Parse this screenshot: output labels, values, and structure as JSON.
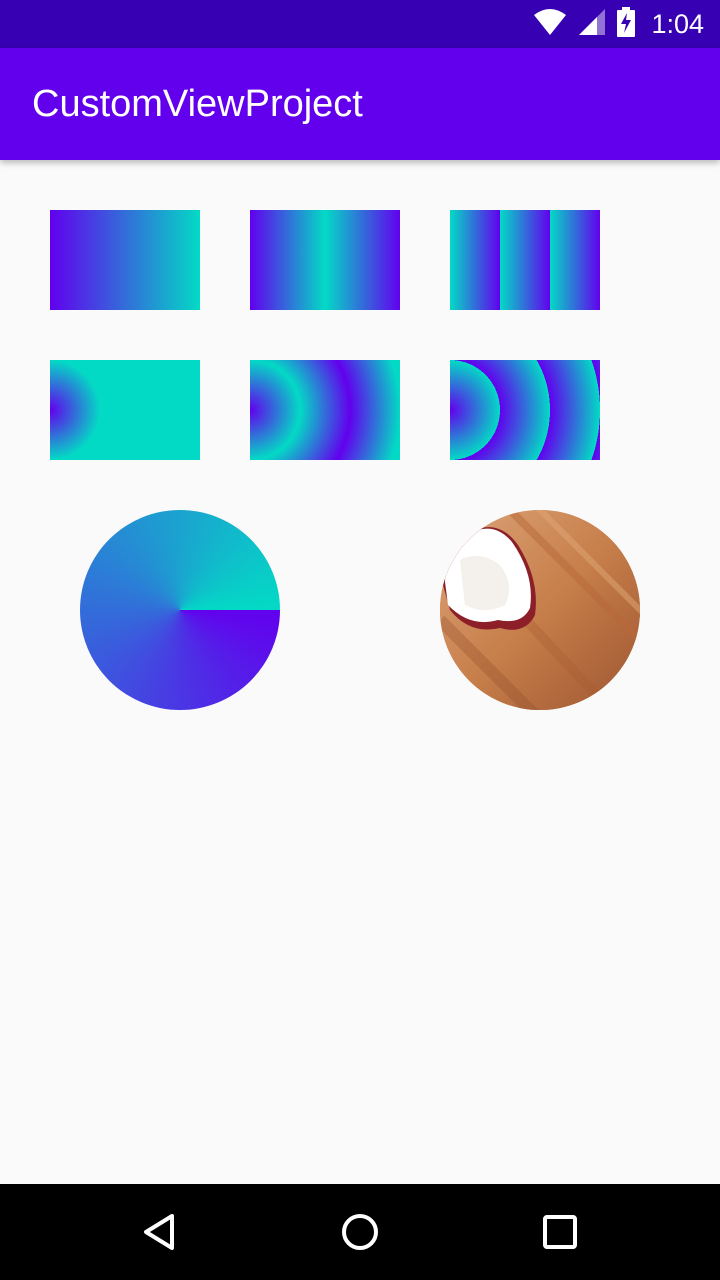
{
  "status_bar": {
    "time": "1:04",
    "icons": [
      "wifi-icon",
      "cell-signal-icon",
      "battery-charging-icon"
    ],
    "background": "#3700b3"
  },
  "app_bar": {
    "title": "CustomViewProject",
    "background": "#6200ee"
  },
  "colors": {
    "accent_purple": "#6200ee",
    "accent_teal": "#03dac5",
    "page_background": "#fafafa"
  },
  "shader_samples": [
    {
      "name": "linear-clamp",
      "type": "linear",
      "tile_mode": "clamp"
    },
    {
      "name": "linear-mirror",
      "type": "linear",
      "tile_mode": "mirror"
    },
    {
      "name": "linear-repeat",
      "type": "linear",
      "tile_mode": "repeat"
    },
    {
      "name": "radial-clamp",
      "type": "radial",
      "tile_mode": "clamp"
    },
    {
      "name": "radial-mirror",
      "type": "radial",
      "tile_mode": "mirror"
    },
    {
      "name": "radial-repeat",
      "type": "radial",
      "tile_mode": "repeat"
    },
    {
      "name": "sweep-circle",
      "type": "sweep"
    },
    {
      "name": "bitmap-circle",
      "type": "bitmap"
    }
  ],
  "nav_bar": {
    "buttons": [
      "back-icon",
      "home-icon",
      "recents-icon"
    ]
  }
}
